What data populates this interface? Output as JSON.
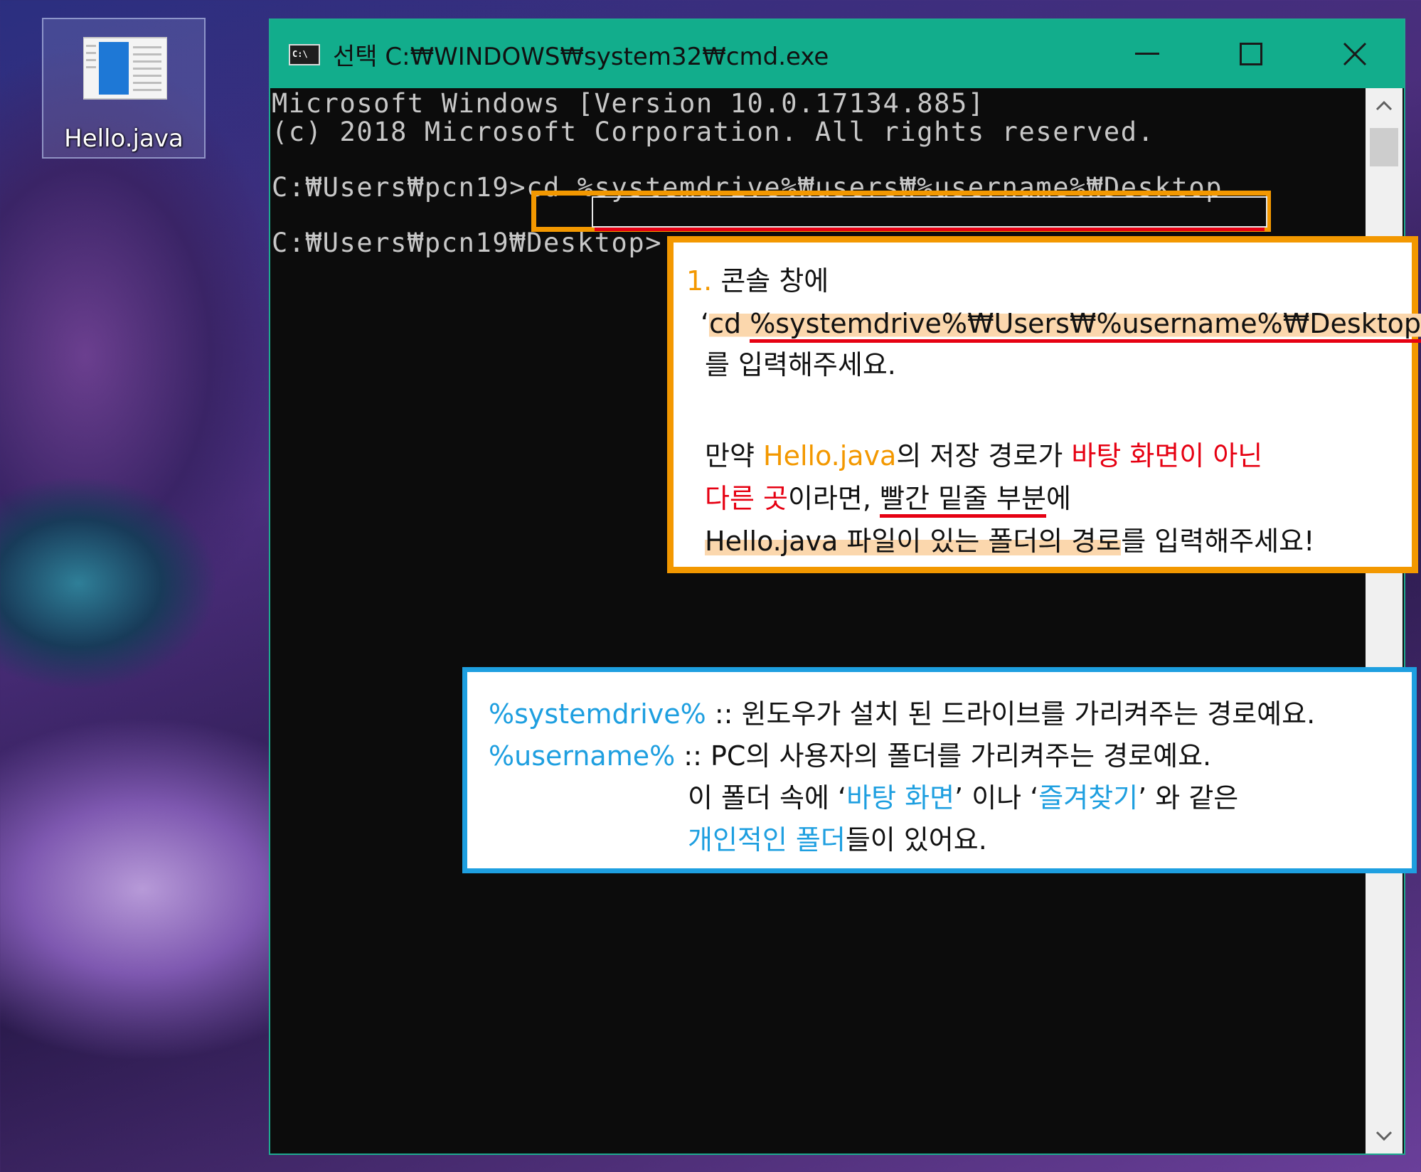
{
  "desktop": {
    "icon_label": "Hello.java"
  },
  "window": {
    "title": "선택 C:₩WINDOWS₩system32₩cmd.exe",
    "icon_text": "C:\\",
    "controls": [
      "minimize-icon",
      "maximize-icon",
      "close-icon"
    ]
  },
  "console": {
    "line1": "Microsoft Windows [Version 10.0.17134.885]",
    "line2": "(c) 2018 Microsoft Corporation. All rights reserved.",
    "prompt1": "C:₩Users₩pcn19>",
    "command_prefix": "cd ",
    "command_path": "%systemdrive%₩users₩%username%₩Desktop",
    "prompt2": "C:₩Users₩pcn19₩Desktop>"
  },
  "callout1": {
    "step": "1.",
    "line1": " 콘솔 창에",
    "quote_open": "‘",
    "cmd_prefix": "cd ",
    "cmd_path": "%systemdrive%₩Users₩%username%₩Desktop",
    "quote_close": "’",
    "line3": "를 입력해주세요.",
    "l4_a": "만약 ",
    "l4_b": "Hello.java",
    "l4_c": "의 저장 경로가 ",
    "l4_d": "바탕 화면이 아닌",
    "l5_a": "다른 곳",
    "l5_b": "이라면,  ",
    "l5_c": "빨간 밑줄 부분",
    "l5_d": "에",
    "l6_a": "Hello.java 파일이 있는 폴더의 경로",
    "l6_b": "를 입력해주세요!"
  },
  "callout2": {
    "k1": "%systemdrive%",
    "d1": " :: 윈도우가 설치 된 드라이브를 가리켜주는 경로예요.",
    "k2": "%username%",
    "d2": " :: PC의 사용자의 폴더를 가리켜주는 경로예요.",
    "l3_a": "이 폴더 속에 ‘",
    "l3_b": "바탕 화면",
    "l3_c": "’ 이나 ‘",
    "l3_d": "즐겨찾기",
    "l3_e": "’ 와 같은",
    "l4_a": "개인적인 폴더",
    "l4_b": "들이 있어요."
  },
  "colors": {
    "titlebar": "#12ad8c",
    "console_bg": "#0c0c0c",
    "console_text": "#c8c8c8",
    "accent_orange": "#f39800",
    "accent_red": "#e60012",
    "accent_blue": "#1e9fe0"
  }
}
